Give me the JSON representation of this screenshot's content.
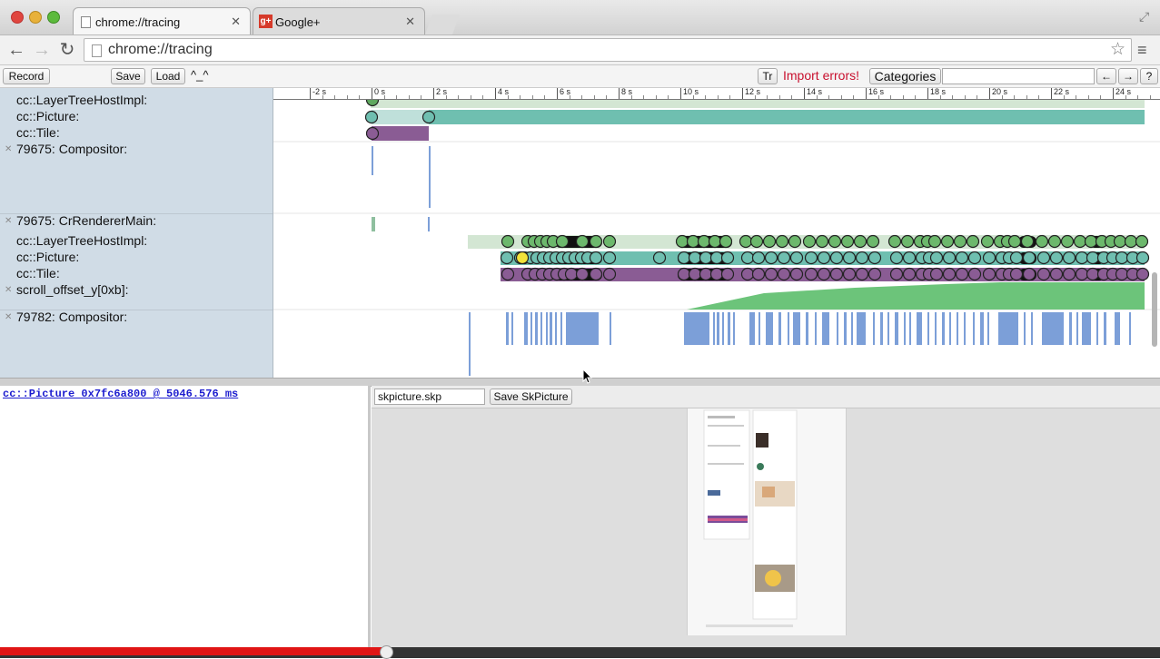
{
  "browser": {
    "tabs": [
      {
        "label": "chrome://tracing",
        "active": true
      },
      {
        "label": "Google+",
        "active": false
      }
    ],
    "url": "chrome://tracing"
  },
  "tracing_toolbar": {
    "record": "Record",
    "save": "Save",
    "load": "Load",
    "caret": "^_^",
    "tr": "Tr",
    "import_errors": "Import errors!",
    "categories": "Categories",
    "search_value": "",
    "prev": "←",
    "next": "→",
    "help": "?"
  },
  "ruler_ticks": [
    "-2 s",
    "0 s",
    "2 s",
    "4 s",
    "6 s",
    "8 s",
    "10 s",
    "12 s",
    "14 s",
    "16 s",
    "18 s",
    "20 s",
    "22 s",
    "24 s"
  ],
  "tracks": [
    {
      "label": "cc::LayerTreeHostImpl:",
      "closable": false
    },
    {
      "label": "cc::Picture:",
      "closable": false
    },
    {
      "label": "cc::Tile:",
      "closable": false
    },
    {
      "label": "79675: Compositor:",
      "closable": true
    },
    {
      "label": "79675: CrRendererMain:",
      "closable": true
    },
    {
      "label": "cc::LayerTreeHostImpl:",
      "closable": false
    },
    {
      "label": "cc::Picture:",
      "closable": false
    },
    {
      "label": "cc::Tile:",
      "closable": false
    },
    {
      "label": "scroll_offset_y[0xb]:",
      "closable": true
    },
    {
      "label": "79782: Compositor:",
      "closable": true
    }
  ],
  "colors": {
    "lthi": "#d3e6d3",
    "picture": "#6fbfb0",
    "tile": "#8a5c94",
    "counter": "#6cc47a",
    "slice": "#7c9fd8",
    "import_errors": "#c8102e"
  },
  "bottom": {
    "picture_title": "cc::Picture 0x7fc6a800 @ 5046.576 ms",
    "skp_filename": "skpicture.skp",
    "save_button": "Save SkPicture"
  }
}
